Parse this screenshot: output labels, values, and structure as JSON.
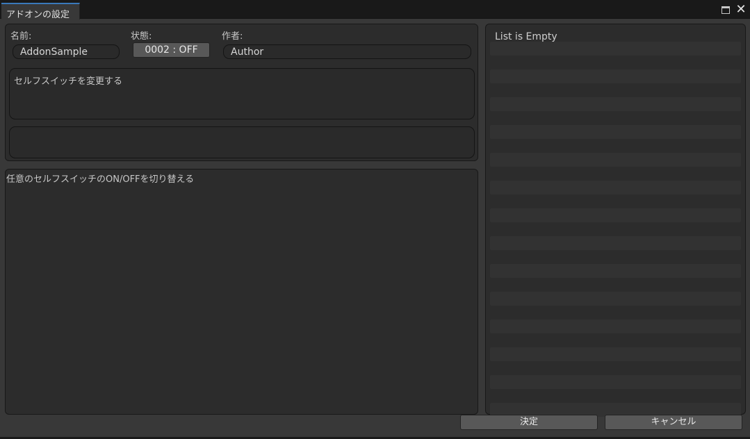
{
  "window": {
    "tab_title": "アドオンの設定",
    "close_glyph": "✕"
  },
  "addon": {
    "name_label": "名前:",
    "name_value": "AddonSample",
    "state_label": "状態:",
    "state_value": "0002 : OFF",
    "author_label": "作者:",
    "author_value": "Author",
    "function_text": "セルフスイッチを変更する",
    "extra_text": "",
    "description": "任意のセルフスイッチのON/OFFを切り替える"
  },
  "list": {
    "empty_text": "List is Empty"
  },
  "footer": {
    "ok_label": "決定",
    "cancel_label": "キャンセル"
  },
  "colors": {
    "accent": "#3a79bb",
    "window_bg": "#383838",
    "panel_bg": "#2c2c2c",
    "button_bg": "#585858"
  }
}
